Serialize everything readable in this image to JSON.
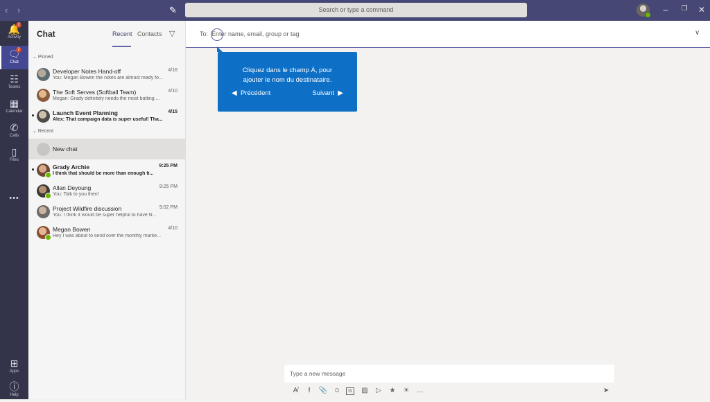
{
  "titlebar": {
    "back_icon": "chevron-left-icon",
    "forward_icon": "chevron-right-icon",
    "compose_icon": "compose-icon",
    "search_placeholder": "Search or type a command"
  },
  "rail": {
    "items": [
      {
        "label": "Activity",
        "icon": "bell-icon",
        "badge": "2"
      },
      {
        "label": "Chat",
        "icon": "chat-icon",
        "badge": "2"
      },
      {
        "label": "Teams",
        "icon": "teams-icon"
      },
      {
        "label": "Calendar",
        "icon": "calendar-icon"
      },
      {
        "label": "Calls",
        "icon": "phone-icon"
      },
      {
        "label": "Files",
        "icon": "file-icon"
      }
    ],
    "apps_label": "Apps",
    "help_label": "Help"
  },
  "panel": {
    "title": "Chat",
    "tabs": {
      "recent": "Recent",
      "contacts": "Contacts"
    },
    "pinned_label": "Pinned",
    "recent_label": "Recent",
    "pinned": [
      {
        "name": "Developer Notes Hand-off",
        "preview": "You: Megan Bowen the notes are almost ready fo...",
        "time": "4/16"
      },
      {
        "name": "The Soft Serves (Softball Team)",
        "preview": "Megan: Grady definitely needs the most batting ...",
        "time": "4/10"
      },
      {
        "name": "Launch Event Planning",
        "preview": "Alex: That campaign data is super useful! Tha...",
        "time": "4/15"
      }
    ],
    "new_chat": "New chat",
    "recent": [
      {
        "name": "Grady Archie",
        "preview": "I think that should be more than enough ti...",
        "time": "9:25 PM"
      },
      {
        "name": "Allan Deyoung",
        "preview": "You: Talk to you then!",
        "time": "9:25 PM"
      },
      {
        "name": "Project Wildfire discussion",
        "preview": "You: I think it would be super helpful to have N...",
        "time": "9:02 PM"
      },
      {
        "name": "Megan Bowen",
        "preview": "Hey I was about to send over the monthly marke...",
        "time": "4/10"
      }
    ]
  },
  "to_bar": {
    "label": "To:",
    "placeholder": "Enter name, email, group or tag"
  },
  "tooltip": {
    "text_line1": "Cliquez dans le champ À, pour",
    "text_line2": "ajouter le nom du destinataire.",
    "prev": "Précédent",
    "next": "Suivant"
  },
  "composer": {
    "placeholder": "Type a new message"
  },
  "colors": {
    "titlebar": "#464775",
    "rail": "#33344a",
    "accent": "#6264a7",
    "tooltip": "#0d6fc6"
  }
}
